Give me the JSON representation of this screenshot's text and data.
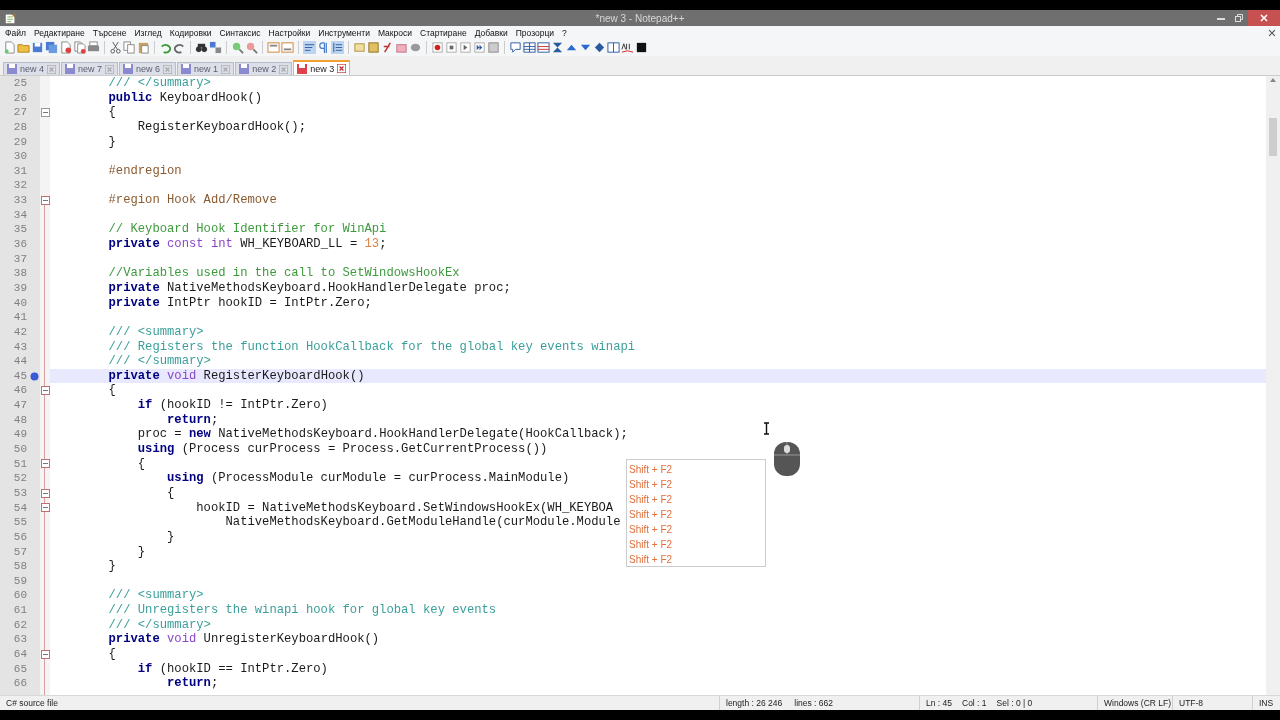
{
  "window": {
    "title": "*new 3 - Notepad++"
  },
  "menu": [
    "Файл",
    "Редактиране",
    "Търсене",
    "Изглед",
    "Кодировки",
    "Синтаксис",
    "Настройки",
    "Инструменти",
    "Макроси",
    "Стартиране",
    "Добавки",
    "Прозорци",
    "?"
  ],
  "tabs": [
    {
      "label": "new 4",
      "selected": false,
      "modified": false
    },
    {
      "label": "new 7",
      "selected": false,
      "modified": false
    },
    {
      "label": "new 6",
      "selected": false,
      "modified": false
    },
    {
      "label": "new 1",
      "selected": false,
      "modified": false
    },
    {
      "label": "new 2",
      "selected": false,
      "modified": false
    },
    {
      "label": "new 3",
      "selected": true,
      "modified": true
    }
  ],
  "editor": {
    "lines": [
      {
        "number": "25",
        "current": false,
        "bookmark": false,
        "fold": false,
        "tokens": [
          {
            "kind": "doc",
            "text": "        /// </summary>"
          }
        ]
      },
      {
        "number": "26",
        "current": false,
        "bookmark": false,
        "fold": false,
        "tokens": [
          {
            "kind": "keyword",
            "text": "        public"
          },
          {
            "kind": "plain",
            "text": " KeyboardHook()"
          }
        ]
      },
      {
        "number": "27",
        "current": false,
        "bookmark": false,
        "fold": true,
        "tokens": [
          {
            "kind": "plain",
            "text": "        {"
          }
        ]
      },
      {
        "number": "28",
        "current": false,
        "bookmark": false,
        "fold": false,
        "tokens": [
          {
            "kind": "plain",
            "text": "            RegisterKeyboardHook();"
          }
        ]
      },
      {
        "number": "29",
        "current": false,
        "bookmark": false,
        "fold": false,
        "tokens": [
          {
            "kind": "plain",
            "text": "        }"
          }
        ]
      },
      {
        "number": "30",
        "current": false,
        "bookmark": false,
        "fold": false
      },
      {
        "number": "31",
        "current": false,
        "bookmark": false,
        "fold": false,
        "tokens": [
          {
            "kind": "preprocessor",
            "text": "        #endregion"
          }
        ]
      },
      {
        "number": "32",
        "current": false,
        "bookmark": false,
        "fold": false
      },
      {
        "number": "33",
        "current": false,
        "bookmark": false,
        "fold": true,
        "tokens": [
          {
            "kind": "preprocessor",
            "text": "        #region Hook Add/Remove"
          }
        ]
      },
      {
        "number": "34",
        "current": false,
        "bookmark": false,
        "fold": false
      },
      {
        "number": "35",
        "current": false,
        "bookmark": false,
        "fold": false,
        "tokens": [
          {
            "kind": "comment",
            "text": "        // Keyboard Hook Identifier for WinApi"
          }
        ]
      },
      {
        "number": "36",
        "current": false,
        "bookmark": false,
        "fold": false,
        "tokens": [
          {
            "kind": "keyword",
            "text": "        private"
          },
          {
            "kind": "type",
            "text": " const"
          },
          {
            "kind": "type",
            "text": " int"
          },
          {
            "kind": "plain",
            "text": " WH_KEYBOARD_LL = "
          },
          {
            "kind": "number",
            "text": "13"
          },
          {
            "kind": "plain",
            "text": ";"
          }
        ]
      },
      {
        "number": "37",
        "current": false,
        "bookmark": false,
        "fold": false
      },
      {
        "number": "38",
        "current": false,
        "bookmark": false,
        "fold": false,
        "tokens": [
          {
            "kind": "comment",
            "text": "        //Variables used in the call to SetWindowsHookEx"
          }
        ]
      },
      {
        "number": "39",
        "current": false,
        "bookmark": false,
        "fold": false,
        "tokens": [
          {
            "kind": "keyword",
            "text": "        private"
          },
          {
            "kind": "plain",
            "text": " NativeMethodsKeyboard.HookHandlerDelegate proc;"
          }
        ]
      },
      {
        "number": "40",
        "current": false,
        "bookmark": false,
        "fold": false,
        "tokens": [
          {
            "kind": "keyword",
            "text": "        private"
          },
          {
            "kind": "plain",
            "text": " IntPtr hookID = IntPtr.Zero;"
          }
        ]
      },
      {
        "number": "41",
        "current": false,
        "bookmark": false,
        "fold": false
      },
      {
        "number": "42",
        "current": false,
        "bookmark": false,
        "fold": false,
        "tokens": [
          {
            "kind": "doc",
            "text": "        /// <summary>"
          }
        ]
      },
      {
        "number": "43",
        "current": false,
        "bookmark": false,
        "fold": false,
        "tokens": [
          {
            "kind": "doc",
            "text": "        /// Registers the function HookCallback for the global key events winapi"
          }
        ]
      },
      {
        "number": "44",
        "current": false,
        "bookmark": false,
        "fold": false,
        "tokens": [
          {
            "kind": "doc",
            "text": "        /// </summary>"
          }
        ]
      },
      {
        "number": "45",
        "current": true,
        "bookmark": true,
        "fold": false,
        "tokens": [
          {
            "kind": "keyword",
            "text": "        private"
          },
          {
            "kind": "type",
            "text": " void"
          },
          {
            "kind": "plain",
            "text": " RegisterKeyboardHook()"
          }
        ]
      },
      {
        "number": "46",
        "current": false,
        "bookmark": false,
        "fold": true,
        "tokens": [
          {
            "kind": "plain",
            "text": "        {"
          }
        ]
      },
      {
        "number": "47",
        "current": false,
        "bookmark": false,
        "fold": false,
        "tokens": [
          {
            "kind": "keyword",
            "text": "            if"
          },
          {
            "kind": "plain",
            "text": " (hookID != IntPtr.Zero)"
          }
        ]
      },
      {
        "number": "48",
        "current": false,
        "bookmark": false,
        "fold": false,
        "tokens": [
          {
            "kind": "keyword",
            "text": "                return"
          },
          {
            "kind": "plain",
            "text": ";"
          }
        ]
      },
      {
        "number": "49",
        "current": false,
        "bookmark": false,
        "fold": false,
        "tokens": [
          {
            "kind": "plain",
            "text": "            proc = "
          },
          {
            "kind": "keyword",
            "text": "new"
          },
          {
            "kind": "plain",
            "text": " NativeMethodsKeyboard.HookHandlerDelegate(HookCallback);"
          }
        ]
      },
      {
        "number": "50",
        "current": false,
        "bookmark": false,
        "fold": false,
        "tokens": [
          {
            "kind": "keyword",
            "text": "            using"
          },
          {
            "kind": "plain",
            "text": " (Process curProcess = Process.GetCurrentProcess())"
          }
        ]
      },
      {
        "number": "51",
        "current": false,
        "bookmark": false,
        "fold": true,
        "tokens": [
          {
            "kind": "plain",
            "text": "            {"
          }
        ]
      },
      {
        "number": "52",
        "current": false,
        "bookmark": false,
        "fold": false,
        "tokens": [
          {
            "kind": "keyword",
            "text": "                using"
          },
          {
            "kind": "plain",
            "text": " (ProcessModule curModule = curProcess.MainModule)"
          }
        ]
      },
      {
        "number": "53",
        "current": false,
        "bookmark": false,
        "fold": true,
        "tokens": [
          {
            "kind": "plain",
            "text": "                {"
          }
        ]
      },
      {
        "number": "54",
        "current": false,
        "bookmark": false,
        "fold": true,
        "tokens": [
          {
            "kind": "plain",
            "text": "                    hookID = NativeMethodsKeyboard.SetWindowsHookEx(WH_KEYBOA"
          }
        ]
      },
      {
        "number": "55",
        "current": false,
        "bookmark": false,
        "fold": false,
        "tokens": [
          {
            "kind": "plain",
            "text": "                        NativeMethodsKeyboard.GetModuleHandle(curModule.Module"
          }
        ]
      },
      {
        "number": "56",
        "current": false,
        "bookmark": false,
        "fold": false,
        "tokens": [
          {
            "kind": "plain",
            "text": "                }"
          }
        ]
      },
      {
        "number": "57",
        "current": false,
        "bookmark": false,
        "fold": false,
        "tokens": [
          {
            "kind": "plain",
            "text": "            }"
          }
        ]
      },
      {
        "number": "58",
        "current": false,
        "bookmark": false,
        "fold": false,
        "tokens": [
          {
            "kind": "plain",
            "text": "        }"
          }
        ]
      },
      {
        "number": "59",
        "current": false,
        "bookmark": false,
        "fold": false
      },
      {
        "number": "60",
        "current": false,
        "bookmark": false,
        "fold": false,
        "tokens": [
          {
            "kind": "doc",
            "text": "        /// <summary>"
          }
        ]
      },
      {
        "number": "61",
        "current": false,
        "bookmark": false,
        "fold": false,
        "tokens": [
          {
            "kind": "doc",
            "text": "        /// Unregisters the winapi hook for global key events"
          }
        ]
      },
      {
        "number": "62",
        "current": false,
        "bookmark": false,
        "fold": false,
        "tokens": [
          {
            "kind": "doc",
            "text": "        /// </summary>"
          }
        ]
      },
      {
        "number": "63",
        "current": false,
        "bookmark": false,
        "fold": false,
        "tokens": [
          {
            "kind": "keyword",
            "text": "        private"
          },
          {
            "kind": "type",
            "text": " void"
          },
          {
            "kind": "plain",
            "text": " UnregisterKeyboardHook()"
          }
        ]
      },
      {
        "number": "64",
        "current": false,
        "bookmark": false,
        "fold": true,
        "tokens": [
          {
            "kind": "plain",
            "text": "        {"
          }
        ]
      },
      {
        "number": "65",
        "current": false,
        "bookmark": false,
        "fold": false,
        "tokens": [
          {
            "kind": "keyword",
            "text": "            if"
          },
          {
            "kind": "plain",
            "text": " (hookID == IntPtr.Zero)"
          }
        ]
      },
      {
        "number": "66",
        "current": false,
        "bookmark": false,
        "fold": false,
        "tokens": [
          {
            "kind": "keyword",
            "text": "                return"
          },
          {
            "kind": "plain",
            "text": ";"
          }
        ]
      }
    ]
  },
  "shortcut_overlay": [
    "Shift + F2",
    "Shift + F2",
    "Shift + F2",
    "Shift + F2",
    "Shift + F2",
    "Shift + F2",
    "Shift + F2"
  ],
  "status_bar": {
    "file_type": "C# source file",
    "length": "length : 26 246",
    "lines": "lines : 662",
    "line": "Ln : 45",
    "column": "Col : 1",
    "selection": "Sel : 0 | 0",
    "eol": "Windows (CR LF)",
    "encoding": "UTF-8",
    "mode": "INS"
  }
}
